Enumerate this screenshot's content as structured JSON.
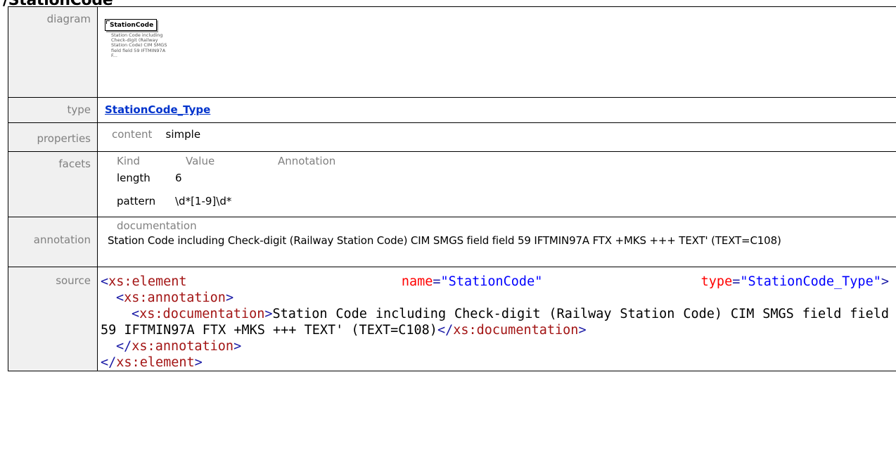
{
  "page": {
    "title": "/StationCode"
  },
  "rows": {
    "diagram": {
      "label": "diagram",
      "box_name": "StationCode",
      "box_doc": "Station Code including Check-digit (Railway Station Code) CIM SMGS field field 59 IFTMIN97A F..."
    },
    "type": {
      "label": "type",
      "link": "StationCode_Type"
    },
    "properties": {
      "label": "properties",
      "key": "content",
      "value": "simple"
    },
    "facets": {
      "label": "facets",
      "headers": [
        "Kind",
        "Value",
        "Annotation"
      ],
      "items": [
        {
          "kind": "length",
          "value": "6"
        },
        {
          "kind": "pattern",
          "value": "\\d*[1-9]\\d*"
        }
      ]
    },
    "annotation": {
      "label": "annotation",
      "heading": "documentation",
      "text": "Station Code including Check-digit (Railway Station Code) CIM SMGS field field 59 IFTMIN97A  FTX +MKS +++ TEXT' (TEXT=C108)"
    },
    "source": {
      "label": "source",
      "element_tag": "xs:element",
      "name_attr": "name",
      "name_value": "\"StationCode\"",
      "type_attr": "type",
      "type_value": "\"StationCode_Type\"",
      "annotation_tag": "xs:annotation",
      "documentation_tag": "xs:documentation",
      "documentation_text": "Station Code including Check-digit (Railway Station Code) CIM SMGS field field 59 IFTMIN97A  FTX +MKS +++ TEXT' (TEXT=C108)"
    }
  }
}
